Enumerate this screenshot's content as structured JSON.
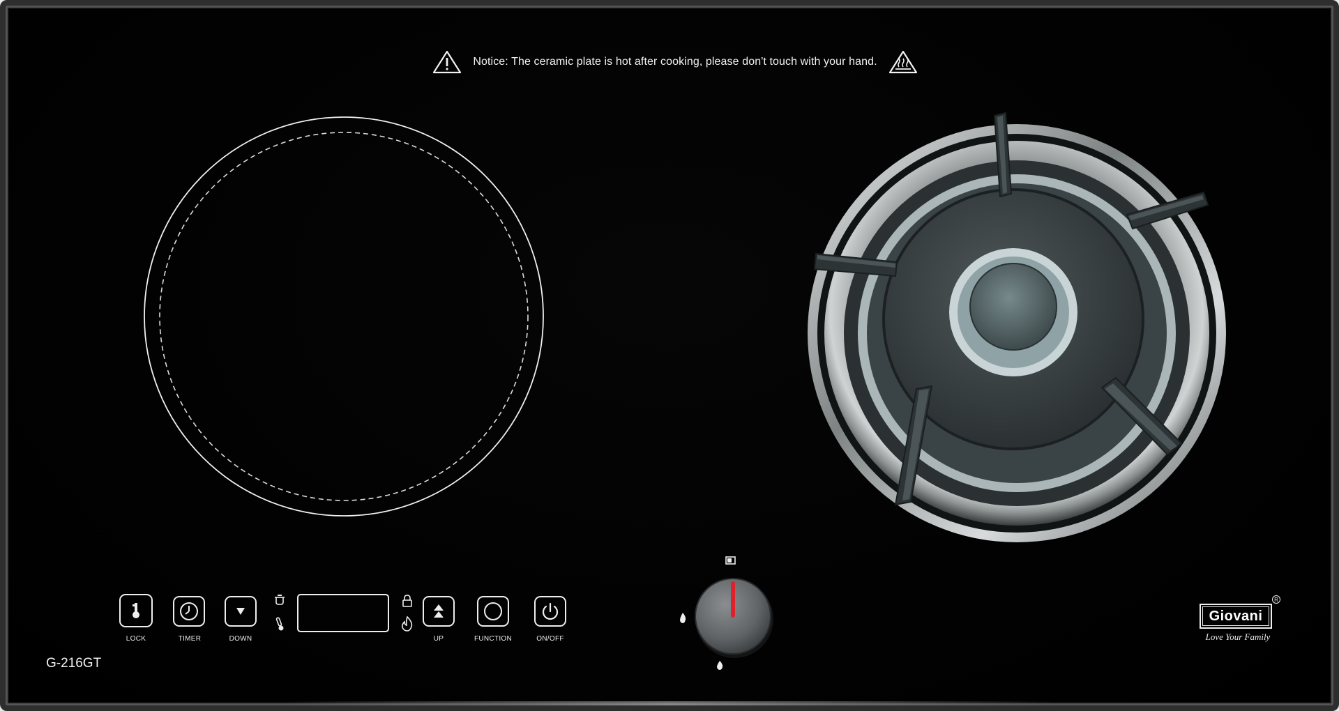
{
  "notice": {
    "text": "Notice: The ceramic plate is hot after cooking, please don't touch with your hand.",
    "left_icon": "warning-triangle-icon",
    "right_icon": "hot-surface-icon"
  },
  "controls": {
    "lock": {
      "label": "LOCK",
      "icon": "lock-key-icon"
    },
    "timer": {
      "label": "TIMER",
      "icon": "clock-icon"
    },
    "down": {
      "label": "DOWN",
      "icon": "triangle-down-icon"
    },
    "up": {
      "label": "UP",
      "icon": "triangle-up-icon"
    },
    "function": {
      "label": "FUNCTION",
      "icon": "circle-icon"
    },
    "onoff": {
      "label": "ON/OFF",
      "icon": "power-icon"
    },
    "indicators": [
      "pot-icon",
      "thermometer-icon",
      "padlock-icon",
      "flame-icon"
    ]
  },
  "model": "G-216GT",
  "knob": {
    "icons": [
      "small-flame-icon",
      "big-flame-icon",
      "battery-icon"
    ],
    "indicator_color": "#e0202a"
  },
  "brand": {
    "name": "Giovani",
    "tagline": "Love Your Family",
    "registered_mark": "R"
  },
  "colors": {
    "glass": "#000000",
    "frame": "#2e2e2e",
    "print": "#eeeeee"
  }
}
